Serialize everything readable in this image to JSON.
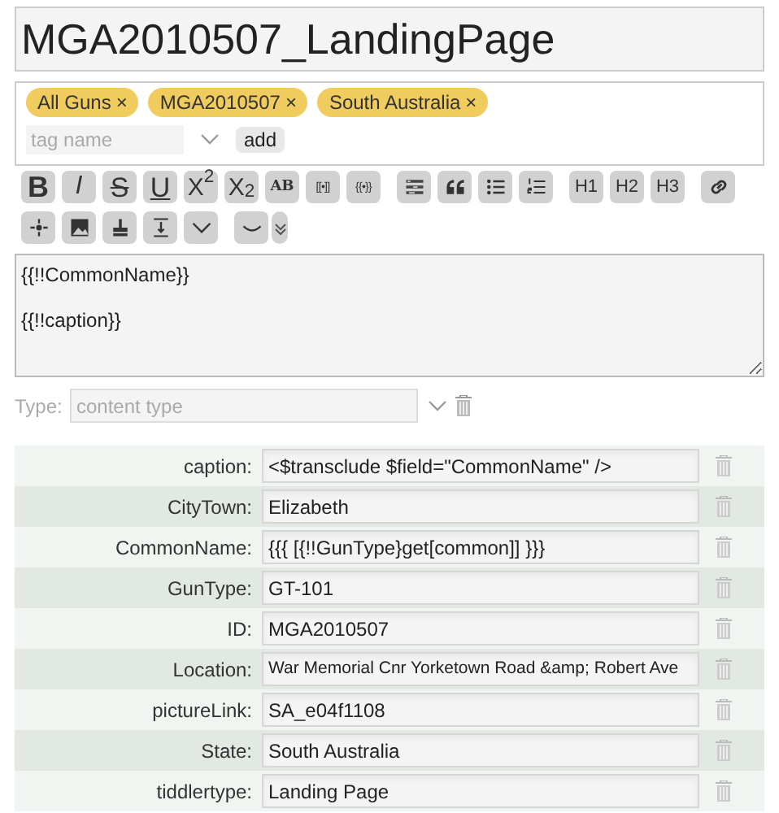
{
  "title": "MGA2010507_LandingPage",
  "tags": [
    {
      "label": "All Guns",
      "remove": "×"
    },
    {
      "label": "MGA2010507",
      "remove": "×"
    },
    {
      "label": "South Australia",
      "remove": "×"
    }
  ],
  "tag_input": {
    "placeholder": "tag name",
    "add": "add"
  },
  "toolbar": [
    [
      [
        {
          "kind": "text",
          "label": "B"
        },
        {
          "kind": "text",
          "label": "I"
        },
        {
          "kind": "text",
          "label": "S"
        },
        {
          "kind": "text",
          "label": "U"
        },
        {
          "kind": "text",
          "label": "X$^{2}$"
        },
        {
          "kind": "text",
          "label": "X$_{2}$"
        },
        {
          "kind": "text",
          "label": "AB"
        },
        {
          "kind": "text",
          "label": "[[•]]"
        },
        {
          "kind": "text",
          "label": "{{•}}"
        }
      ],
      [
        {
          "kind": "icon"
        },
        {
          "kind": "icon"
        },
        {
          "kind": "icon"
        },
        {
          "kind": "icon"
        }
      ],
      [
        {
          "kind": "text",
          "label": "H1"
        },
        {
          "kind": "text",
          "label": "H2"
        },
        {
          "kind": "text",
          "label": "H3"
        }
      ],
      [
        {
          "kind": "icon"
        }
      ]
    ],
    [
      [
        {
          "kind": "icon"
        },
        {
          "kind": "icon"
        },
        {
          "kind": "icon"
        },
        {
          "kind": "icon"
        },
        {
          "kind": "icon"
        }
      ],
      [
        {
          "kind": "icon"
        },
        {
          "kind": "icon"
        }
      ]
    ]
  ],
  "body": "{{!!CommonName}}\n\n{{!!caption}}",
  "type_row": {
    "label": "Type:",
    "placeholder": "content type"
  },
  "fields": [
    {
      "name": "caption:",
      "value": "<$transclude $field=\"CommonName\" />"
    },
    {
      "name": "CityTown:",
      "value": "Elizabeth"
    },
    {
      "name": "CommonName:",
      "value": "{{{ [{!!GunType}get[common]] }}}"
    },
    {
      "name": "GunType:",
      "value": "GT-101"
    },
    {
      "name": "ID:",
      "value": "MGA2010507"
    },
    {
      "name": "Location:",
      "value": "War Memorial Cnr Yorketown Road &amp; Robert Ave"
    },
    {
      "name": "pictureLink:",
      "value": "SA_e04f1108"
    },
    {
      "name": "State:",
      "value": "South Australia"
    },
    {
      "name": "tiddlertype:",
      "value": "Landing Page"
    }
  ]
}
